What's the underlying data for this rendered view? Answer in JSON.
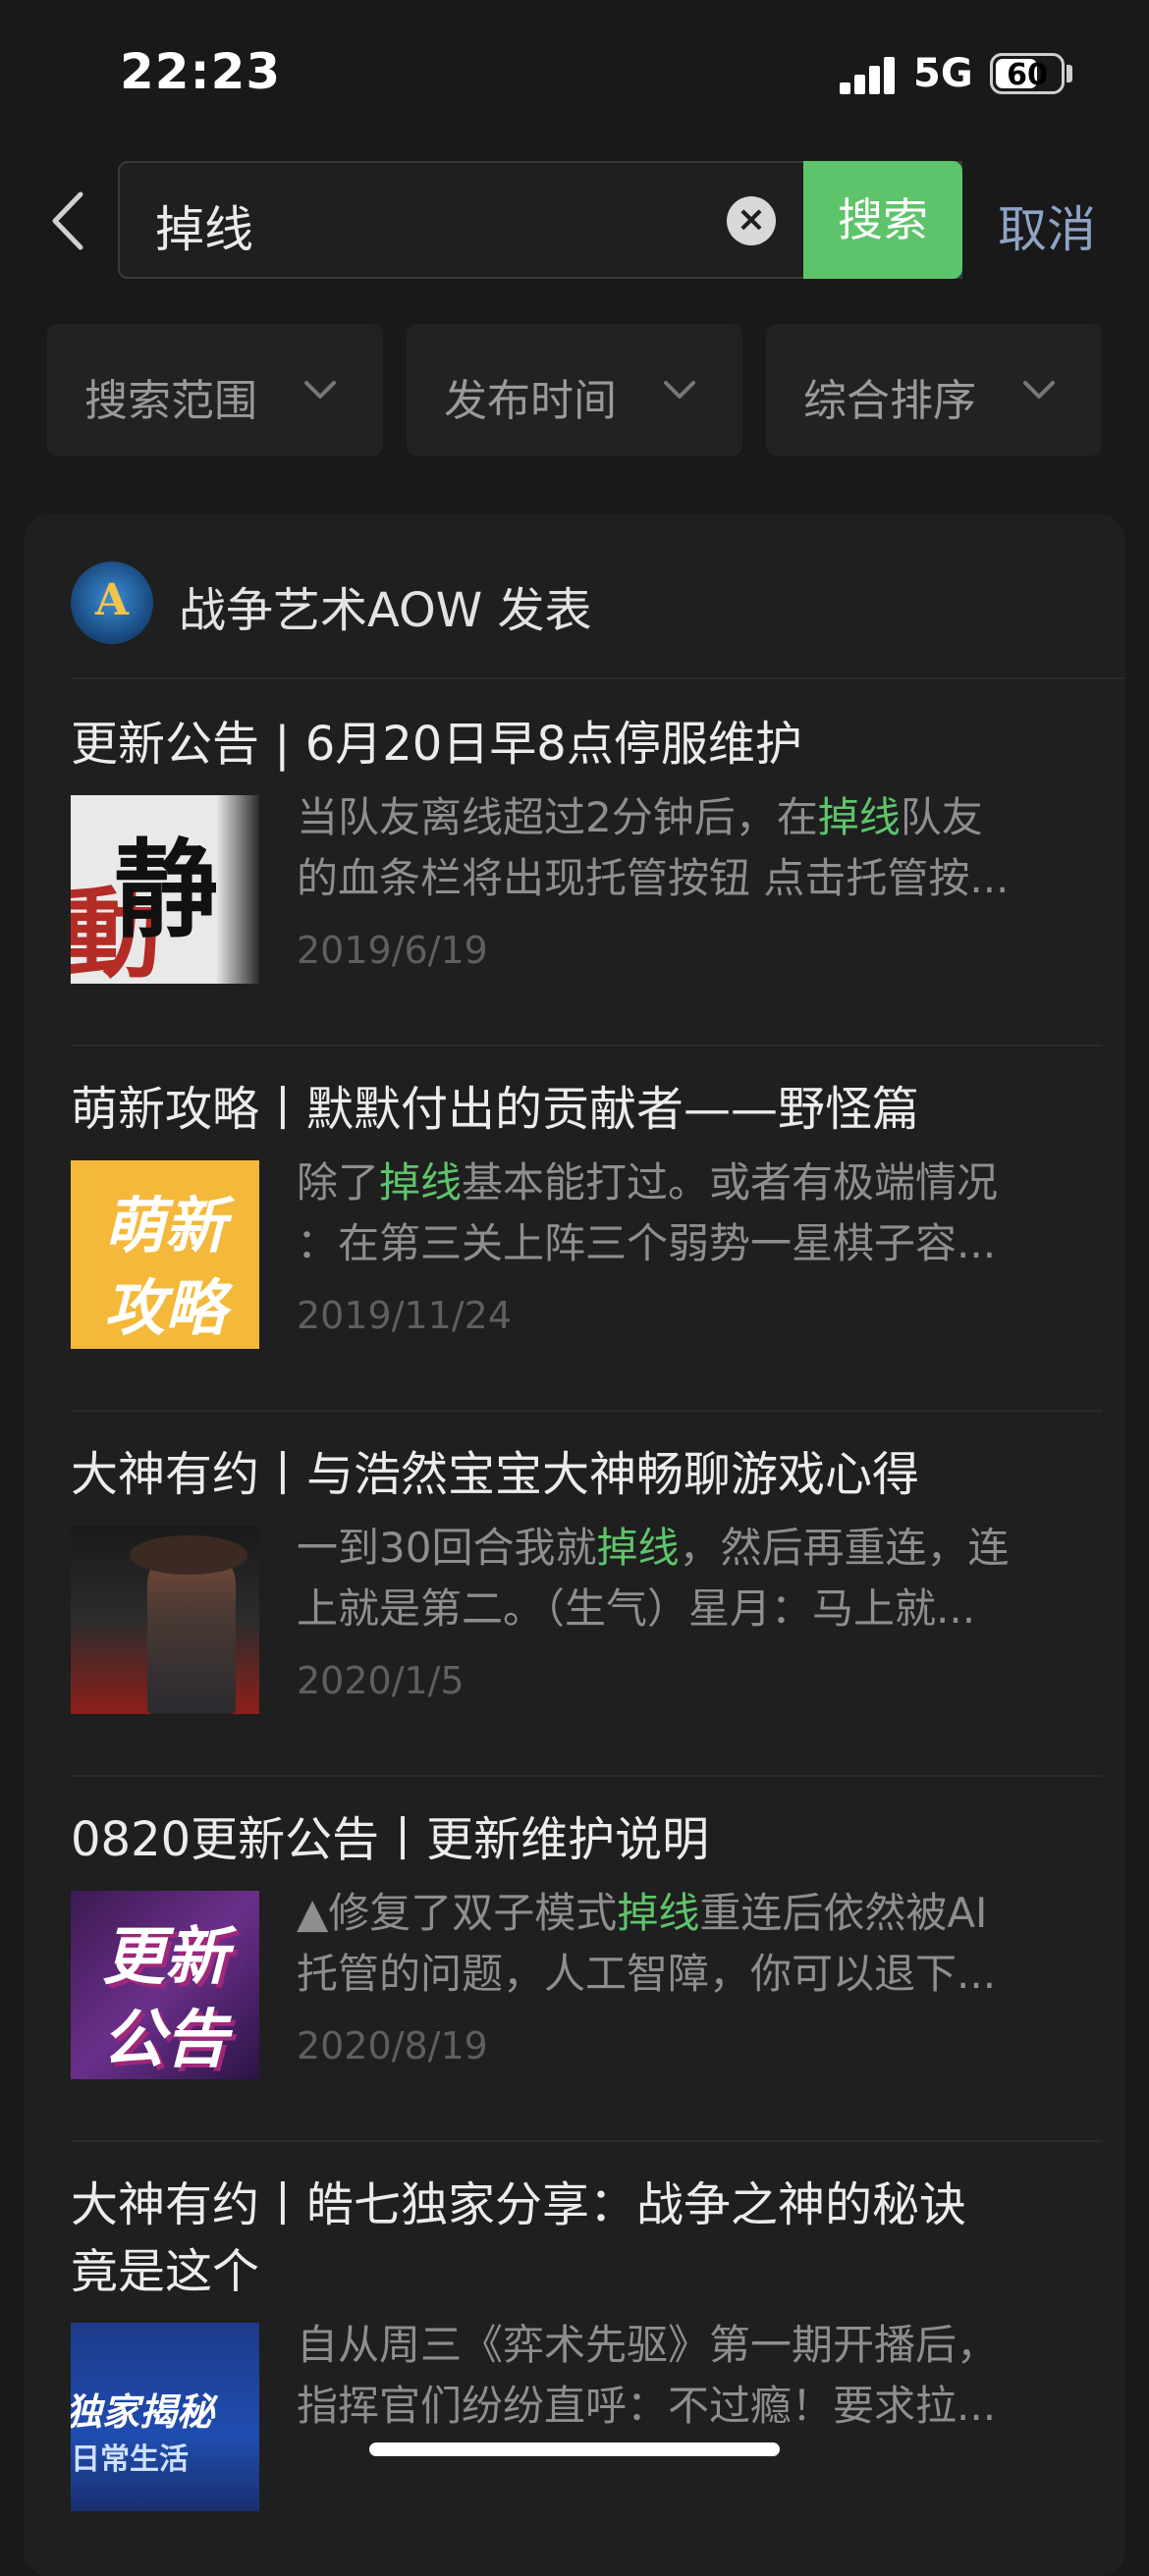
{
  "status_bar": {
    "time": "22:23",
    "network": "5G",
    "battery": "60"
  },
  "search": {
    "query": "掉线",
    "submit_label": "搜索",
    "cancel_label": "取消"
  },
  "filters": [
    {
      "label": "搜索范围"
    },
    {
      "label": "发布时间"
    },
    {
      "label": "综合排序"
    }
  ],
  "account": {
    "avatar_letter": "A",
    "name": "战争艺术AOW 发表"
  },
  "highlight_color": "#5ec46b",
  "results": [
    {
      "title": "更新公告 | 6月20日早8点停服维护",
      "thumb_text": [
        "静",
        "動"
      ],
      "snippet_line1": {
        "before": "当队友离线超过2分钟后，在",
        "hl": "掉线",
        "after": "队友"
      },
      "snippet_line2": "的血条栏将出现托管按钮 点击托管按...",
      "date": "2019/6/19"
    },
    {
      "title": "萌新攻略丨默默付出的贡献者——野怪篇",
      "thumb_text": [
        "萌新",
        "攻略"
      ],
      "snippet_line1": {
        "before": "除了",
        "hl": "掉线",
        "after": "基本能打过。或者有极端情况"
      },
      "snippet_line2": "：在第三关上阵三个弱势一星棋子容...",
      "date": "2019/11/24"
    },
    {
      "title": "大神有约丨与浩然宝宝大神畅聊游戏心得",
      "thumb_text": [],
      "snippet_line1": {
        "before": "一到30回合我就",
        "hl": "掉线",
        "after": "，然后再重连，连"
      },
      "snippet_line2": "上就是第二。（生气）星月：马上就...",
      "date": "2020/1/5"
    },
    {
      "title": "0820更新公告丨更新维护说明",
      "thumb_text": [
        "更新",
        "公告"
      ],
      "snippet_line1": {
        "before": "▲修复了双子模式",
        "hl": "掉线",
        "after": "重连后依然被AI"
      },
      "snippet_line2": "托管的问题，人工智障，你可以退下...",
      "date": "2020/8/19"
    },
    {
      "title_line1": "大神有约丨皓七独家分享：战争之神的秘诀",
      "title_line2": "竟是这个",
      "thumb_text": [
        "独家揭秘",
        "日常生活"
      ],
      "snippet_line1": "自从周三《弈术先驱》第一期开播后，",
      "snippet_line2": "指挥官们纷纷直呼：不过瘾！要求拉..."
    }
  ]
}
